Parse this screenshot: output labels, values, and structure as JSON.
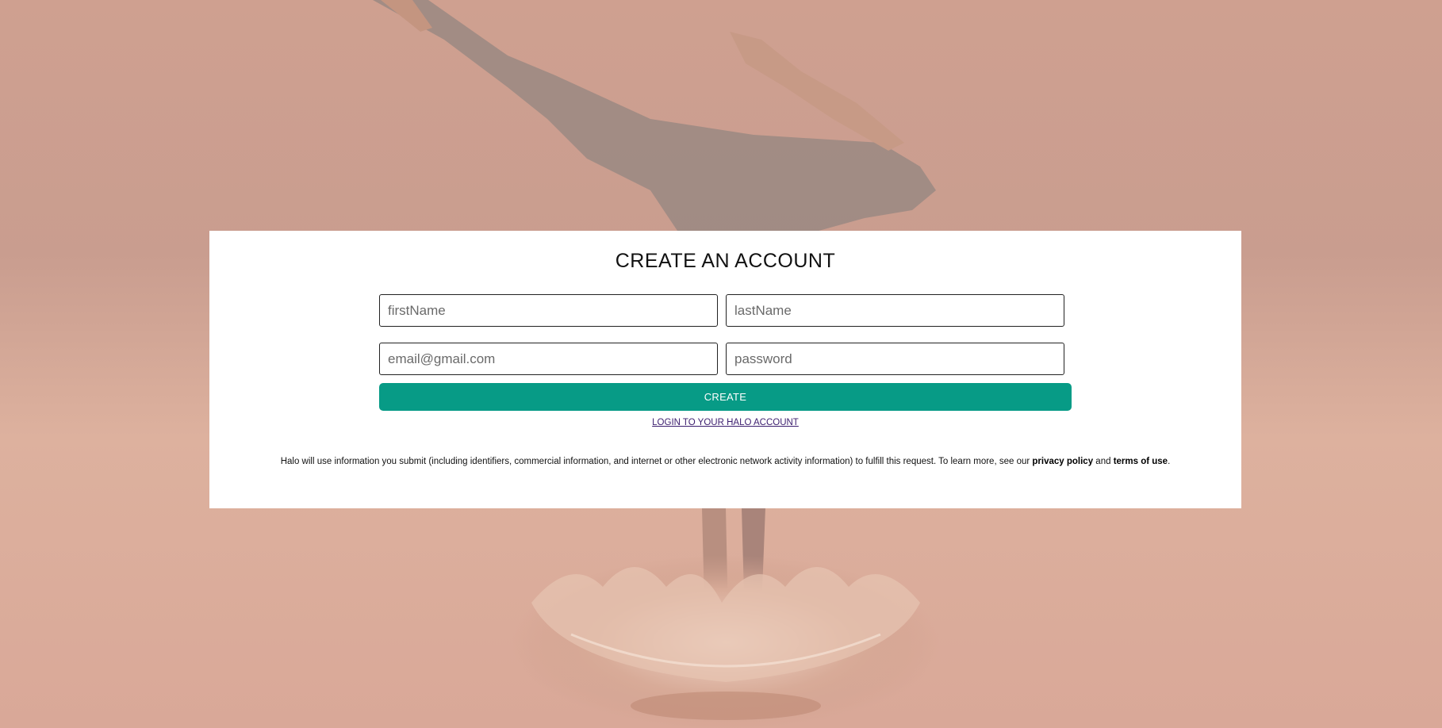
{
  "form": {
    "title": "CREATE AN ACCOUNT",
    "first_name_placeholder": "firstName",
    "last_name_placeholder": "lastName",
    "email_placeholder": "email@gmail.com",
    "password_placeholder": "password",
    "create_label": "CREATE",
    "login_link_label": "LOGIN TO YOUR HALO ACCOUNT"
  },
  "disclaimer": {
    "text": "Halo will use information you submit (including identifiers, commercial information, and internet or other electronic network activity information) to fulfill this request. To learn more, see our ",
    "privacy_label": "privacy policy",
    "and": " and ",
    "terms_label": "terms of use",
    "end": "."
  },
  "colors": {
    "accent": "#079b86",
    "background": "#d2a696",
    "link": "#3b1d6e"
  }
}
